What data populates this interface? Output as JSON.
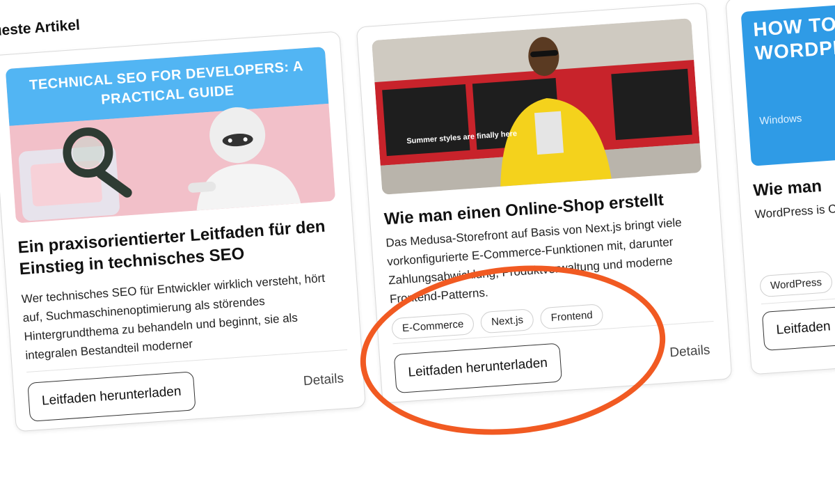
{
  "section": {
    "title": "Neueste Artikel"
  },
  "cards": [
    {
      "banner": "TECHNICAL SEO FOR DEVELOPERS: A PRACTICAL GUIDE",
      "title": "Ein praxisorientierter Leitfaden für den Einstieg in technisches SEO",
      "description": "Wer technisches SEO für Entwickler wirklich versteht, hört auf, Suchmaschinenoptimierung als störendes Hintergrundthema zu behandeln und beginnt, sie als integralen Bestandteil moderner",
      "primary_button": "Leitfaden herunterladen",
      "secondary_button": "Details",
      "tags": []
    },
    {
      "image_text": "Summer styles are finally here",
      "title": "Wie man einen Online-Shop erstellt",
      "description": "Das Medusa-Storefront auf Basis von Next.js bringt viele vorkonfigurierte E-Commerce-Funktionen mit, darunter Zahlungsabwicklung, Produktverwaltung und moderne Frontend-Patterns.",
      "tags": [
        "E-Commerce",
        "Next.js",
        "Frontend"
      ],
      "primary_button": "Leitfaden herunterladen",
      "secondary_button": "Details"
    },
    {
      "banner_big": "HOW TO LOCALLY INSTALL WORDPRESS",
      "banner_small": "Windows",
      "title": "Wie man",
      "description": "WordPress is Content-Ma Websites ers",
      "tags": [
        "WordPress"
      ],
      "primary_button": "Leitfaden"
    }
  ],
  "colors": {
    "highlight": "#f15a22",
    "banner_blue": "#52b5f3"
  }
}
